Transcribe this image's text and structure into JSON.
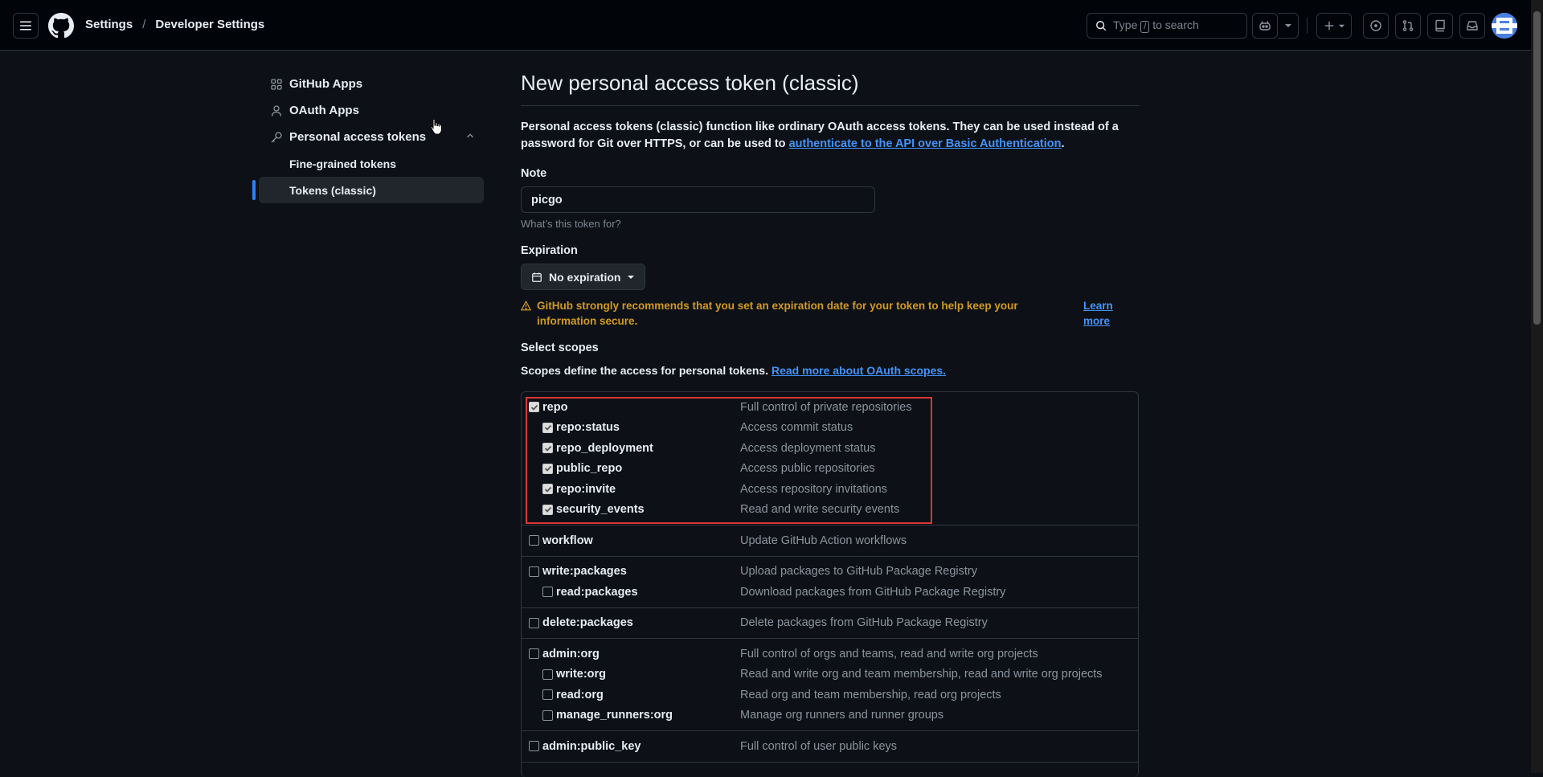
{
  "header": {
    "breadcrumbs": [
      "Settings",
      "Developer Settings"
    ],
    "search_prefix": "Type",
    "search_key": "/",
    "search_suffix": "to search"
  },
  "sidebar": {
    "items": [
      {
        "label": "GitHub Apps",
        "icon": "apps-icon"
      },
      {
        "label": "OAuth Apps",
        "icon": "person-icon"
      },
      {
        "label": "Personal access tokens",
        "icon": "key-icon"
      }
    ],
    "subitems": [
      {
        "label": "Fine-grained tokens"
      },
      {
        "label": "Tokens (classic)",
        "active": true
      }
    ]
  },
  "main": {
    "title": "New personal access token (classic)",
    "desc_text": "Personal access tokens (classic) function like ordinary OAuth access tokens. They can be used instead of a password for Git over HTTPS, or can be used to",
    "desc_link": "authenticate to the API over Basic Authentication",
    "desc_end": ".",
    "note_label": "Note",
    "note_value": "picgo",
    "note_hint": "What’s this token for?",
    "expiration_label": "Expiration",
    "expiration_value": "No expiration",
    "warning": "GitHub strongly recommends that you set an expiration date for your token to help keep your information secure.",
    "learn_more": "Learn more",
    "scopes_label": "Select scopes",
    "scopes_desc": "Scopes define the access for personal tokens.",
    "scopes_link": "Read more about OAuth scopes."
  },
  "scopes": [
    {
      "items": [
        {
          "name": "repo",
          "desc": "Full control of private repositories",
          "checked": true,
          "child": false
        },
        {
          "name": "repo:status",
          "desc": "Access commit status",
          "checked": true,
          "child": true
        },
        {
          "name": "repo_deployment",
          "desc": "Access deployment status",
          "checked": true,
          "child": true
        },
        {
          "name": "public_repo",
          "desc": "Access public repositories",
          "checked": true,
          "child": true
        },
        {
          "name": "repo:invite",
          "desc": "Access repository invitations",
          "checked": true,
          "child": true
        },
        {
          "name": "security_events",
          "desc": "Read and write security events",
          "checked": true,
          "child": true
        }
      ]
    },
    {
      "items": [
        {
          "name": "workflow",
          "desc": "Update GitHub Action workflows",
          "checked": false,
          "child": false
        }
      ]
    },
    {
      "items": [
        {
          "name": "write:packages",
          "desc": "Upload packages to GitHub Package Registry",
          "checked": false,
          "child": false
        },
        {
          "name": "read:packages",
          "desc": "Download packages from GitHub Package Registry",
          "checked": false,
          "child": true
        }
      ]
    },
    {
      "items": [
        {
          "name": "delete:packages",
          "desc": "Delete packages from GitHub Package Registry",
          "checked": false,
          "child": false
        }
      ]
    },
    {
      "items": [
        {
          "name": "admin:org",
          "desc": "Full control of orgs and teams, read and write org projects",
          "checked": false,
          "child": false
        },
        {
          "name": "write:org",
          "desc": "Read and write org and team membership, read and write org projects",
          "checked": false,
          "child": true
        },
        {
          "name": "read:org",
          "desc": "Read org and team membership, read org projects",
          "checked": false,
          "child": true
        },
        {
          "name": "manage_runners:org",
          "desc": "Manage org runners and runner groups",
          "checked": false,
          "child": true
        }
      ]
    },
    {
      "items": [
        {
          "name": "admin:public_key",
          "desc": "Full control of user public keys",
          "checked": false,
          "child": false
        }
      ]
    }
  ]
}
